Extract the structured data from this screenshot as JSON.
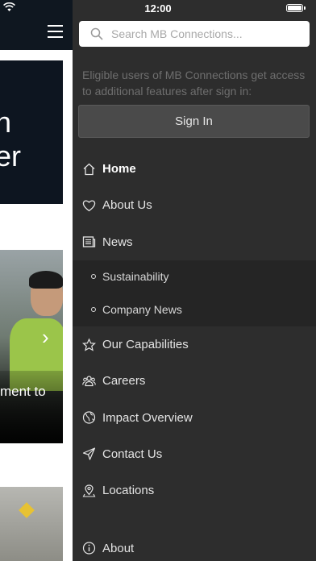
{
  "status": {
    "time": "12:00"
  },
  "search": {
    "placeholder": "Search MB Connections..."
  },
  "signin": {
    "note": "Eligible users of MB Connections get access to additional features after sign in:",
    "button_label": "Sign In"
  },
  "menu": {
    "home": "Home",
    "about_us": "About Us",
    "news": "News",
    "news_sub": [
      "Sustainability",
      "Company News"
    ],
    "capabilities": "Our Capabilities",
    "careers": "Careers",
    "impact": "Impact Overview",
    "contact": "Contact Us",
    "locations": "Locations",
    "about": "About"
  },
  "background": {
    "hero_line1": "n",
    "hero_line2": "er",
    "photo_caption": "ment to"
  }
}
